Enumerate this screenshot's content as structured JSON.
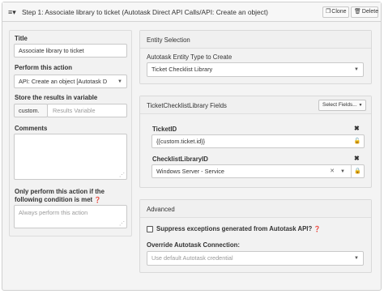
{
  "header": {
    "menu_icon": "≡▾",
    "title": "Step 1: Associate library to ticket (Autotask Direct API Calls/API: Create an object)",
    "clone_label": "Clone",
    "delete_label": "Delete",
    "clone_icon": "copy-icon",
    "delete_icon": "trash-icon"
  },
  "left": {
    "title_label": "Title",
    "title_value": "Associate library to ticket",
    "perform_label": "Perform this action",
    "perform_value": "API: Create an object [Autotask D",
    "store_label": "Store the results in variable",
    "store_prefix": "custom.",
    "store_placeholder": "Results Variable",
    "comments_label": "Comments",
    "condition_label_line1": "Only perform this action if the",
    "condition_label_line2": "following condition is met",
    "condition_placeholder": "Always perform this action"
  },
  "entity": {
    "header": "Entity Selection",
    "type_label": "Autotask Entity Type to Create",
    "type_value": "Ticket Checklist Library"
  },
  "fields": {
    "header": "TicketChecklistLibrary Fields",
    "select_button": "Select Fields...",
    "ticket_id_label": "TicketID",
    "ticket_id_value": "{{custom.ticket.id}}",
    "library_label": "ChecklistLibraryID",
    "library_value": "Windows Server - Service"
  },
  "advanced": {
    "header": "Advanced",
    "suppress_label": "Suppress exceptions generated from Autotask API?",
    "suppress_checked": false,
    "override_label": "Override Autotask Connection:",
    "override_placeholder": "Use default Autotask credential"
  }
}
